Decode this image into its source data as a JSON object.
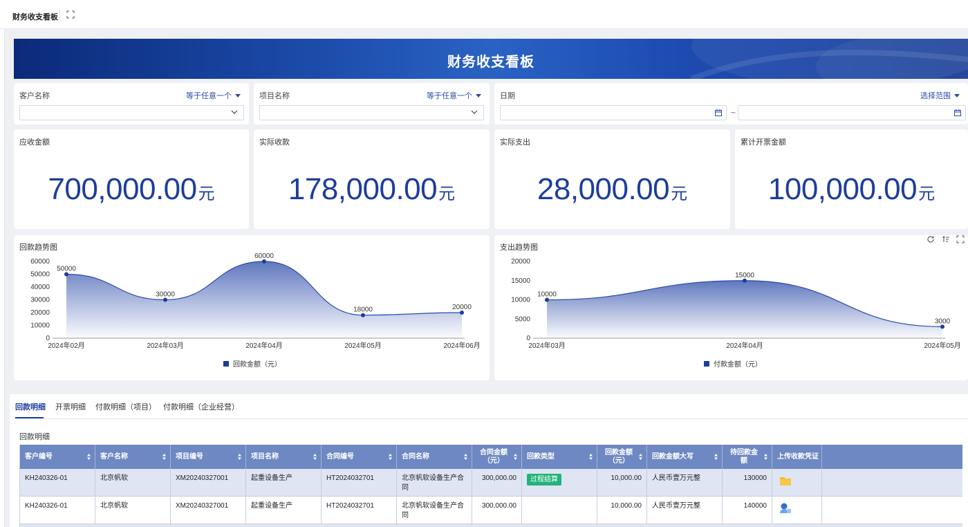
{
  "topbar": {
    "tab_title": "财务收支看板"
  },
  "banner": {
    "title": "财务收支看板"
  },
  "filters": {
    "customer": {
      "label": "客户名称",
      "op": "等于任意一个"
    },
    "project": {
      "label": "项目名称",
      "op": "等于任意一个"
    },
    "date": {
      "label": "日期",
      "op": "选择范围",
      "sep": "~"
    }
  },
  "kpis": [
    {
      "label": "应收金额",
      "value": "700,000.00",
      "unit": "元"
    },
    {
      "label": "实际收款",
      "value": "178,000.00",
      "unit": "元"
    },
    {
      "label": "实际支出",
      "value": "28,000.00",
      "unit": "元"
    },
    {
      "label": "累计开票金额",
      "value": "100,000.00",
      "unit": "元"
    }
  ],
  "chart_data": [
    {
      "type": "area",
      "title": "回款趋势图",
      "categories": [
        "2024年02月",
        "2024年03月",
        "2024年04月",
        "2024年05月",
        "2024年06月"
      ],
      "series": [
        {
          "name": "回款金额（元）",
          "values": [
            50000,
            30000,
            60000,
            18000,
            20000
          ]
        }
      ],
      "ylim": [
        0,
        60000
      ],
      "yticks": [
        0,
        10000,
        20000,
        30000,
        40000,
        50000,
        60000
      ],
      "data_labels": true,
      "legend": "bottom",
      "color": "#2a4aa8"
    },
    {
      "type": "area",
      "title": "支出趋势图",
      "categories": [
        "2024年03月",
        "2024年04月",
        "2024年05月"
      ],
      "series": [
        {
          "name": "付款金额（元）",
          "values": [
            10000,
            15000,
            3000
          ]
        }
      ],
      "ylim": [
        0,
        20000
      ],
      "yticks": [
        0,
        5000,
        10000,
        15000,
        20000
      ],
      "data_labels": true,
      "legend": "bottom",
      "color": "#2a4aa8"
    }
  ],
  "tabs": [
    "回款明细",
    "开票明细",
    "付款明细（项目）",
    "付款明细（企业经营）"
  ],
  "section_title": "回款明细",
  "table": {
    "headers": [
      "客户编号",
      "客户名称",
      "项目编号",
      "项目名称",
      "合同编号",
      "合同名称",
      "合同金额（元）",
      "回款类型",
      "回款金额（元）",
      "回款金额大写",
      "待回款金额",
      "上传收款凭证"
    ],
    "rows": [
      [
        "KH240326-01",
        "北京帆软",
        "XM20240327001",
        "起重设备生产",
        "HT2024032701",
        "北京帆软设备生产合同",
        "300,000.00",
        "过程结算",
        "10,000.00",
        "人民币壹万元整",
        "130000",
        "folder-icon"
      ],
      [
        "KH240326-01",
        "北京帆软",
        "XM20240327001",
        "起重设备生产",
        "HT2024032701",
        "北京帆软设备生产合同",
        "300,000.00",
        "",
        "10,000.00",
        "人民币壹万元整",
        "140000",
        "user-upload-icon"
      ]
    ]
  },
  "colors": {
    "accent": "#1f3f9f",
    "header_bg": "#6d88c2",
    "row_alt": "#dfe5f3",
    "badge": "#22b37a"
  }
}
